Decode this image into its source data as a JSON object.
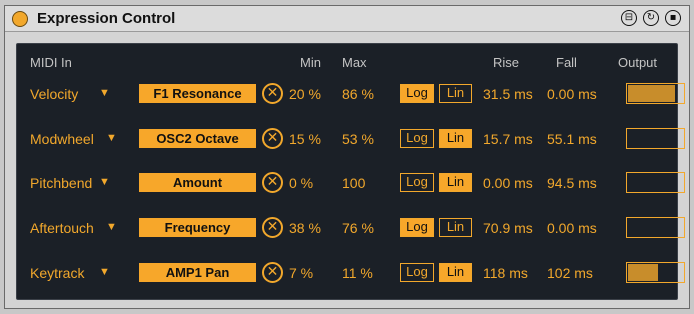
{
  "device": {
    "title": "Expression Control"
  },
  "header_icons": [
    "save-preset-icon",
    "hot-swap-icon",
    "device-save-icon"
  ],
  "columns": {
    "midi_in": "MIDI In",
    "min": "Min",
    "max": "Max",
    "rise": "Rise",
    "fall": "Fall",
    "output": "Output"
  },
  "rows": [
    {
      "source": "Velocity",
      "dest": "F1 Resonance",
      "min": "20 %",
      "max": "86 %",
      "mode": "log",
      "log_label": "Log",
      "lin_label": "Lin",
      "rise": "31.5 ms",
      "fall": "0.00 ms",
      "output": 0.85
    },
    {
      "source": "Modwheel",
      "dest": "OSC2 Octave",
      "min": "15 %",
      "max": "53 %",
      "mode": "lin",
      "log_label": "Log",
      "lin_label": "Lin",
      "rise": "15.7 ms",
      "fall": "55.1 ms",
      "output": 0.0
    },
    {
      "source": "Pitchbend",
      "dest": "Amount",
      "min": "0 %",
      "max": "100",
      "mode": "lin",
      "log_label": "Log",
      "lin_label": "Lin",
      "rise": "0.00 ms",
      "fall": "94.5 ms",
      "output": 0.0
    },
    {
      "source": "Aftertouch",
      "dest": "Frequency",
      "min": "38 %",
      "max": "76 %",
      "mode": "log",
      "log_label": "Log",
      "lin_label": "Lin",
      "rise": "70.9 ms",
      "fall": "0.00 ms",
      "output": 0.0
    },
    {
      "source": "Keytrack",
      "dest": "AMP1 Pan",
      "min": "7 %",
      "max": "11 %",
      "mode": "lin",
      "log_label": "Log",
      "lin_label": "Lin",
      "rise": "118 ms",
      "fall": "102 ms",
      "output": 0.55
    }
  ],
  "colors": {
    "accent": "#f2a82c",
    "panel": "#1b2027",
    "meter_fill": "#c88d2b"
  }
}
